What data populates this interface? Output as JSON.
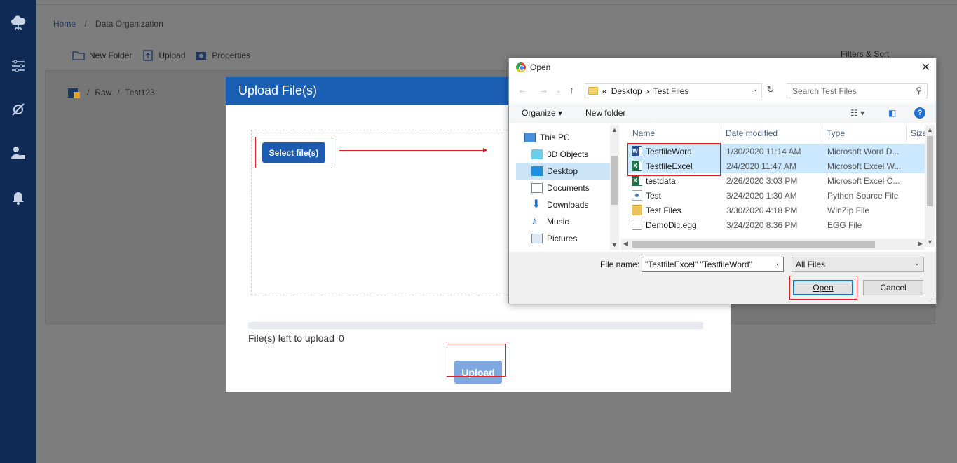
{
  "breadcrumb": {
    "home": "Home",
    "current": "Data Organization"
  },
  "toolbar": {
    "new_folder": "New Folder",
    "upload": "Upload",
    "properties": "Properties",
    "filters": "Filters & Sort"
  },
  "path": {
    "raw": "Raw",
    "folder": "Test123"
  },
  "modal": {
    "title": "Upload File(s)",
    "select_button": "Select file(s)",
    "files_left_label": "File(s) left to upload",
    "files_left_count": "0",
    "upload_button": "Upload",
    "upload_progress": 0
  },
  "dialog": {
    "title": "Open",
    "address": {
      "prefix": "«",
      "crumb1": "Desktop",
      "crumb2": "Test Files"
    },
    "search_placeholder": "Search Test Files",
    "organize": "Organize",
    "new_folder": "New folder",
    "nav_items": [
      "This PC",
      "3D Objects",
      "Desktop",
      "Documents",
      "Downloads",
      "Music",
      "Pictures"
    ],
    "columns": {
      "name": "Name",
      "date": "Date modified",
      "type": "Type",
      "size": "Size"
    },
    "files": [
      {
        "name": "TestfileWord",
        "date": "1/30/2020 11:14 AM",
        "type": "Microsoft Word D...",
        "icon": "word-icon"
      },
      {
        "name": "TestfileExcel",
        "date": "2/4/2020 11:47 AM",
        "type": "Microsoft Excel W...",
        "icon": "excel-icon"
      },
      {
        "name": "testdata",
        "date": "2/26/2020 3:03 PM",
        "type": "Microsoft Excel C...",
        "icon": "excel-icon"
      },
      {
        "name": "Test",
        "date": "3/24/2020 1:30 AM",
        "type": "Python Source File",
        "icon": "python-icon"
      },
      {
        "name": "Test Files",
        "date": "3/30/2020 4:18 PM",
        "type": "WinZip File",
        "icon": "zip-icon"
      },
      {
        "name": "DemoDic.egg",
        "date": "3/24/2020 8:36 PM",
        "type": "EGG File",
        "icon": "file-icon"
      }
    ],
    "file_name_label": "File name:",
    "file_name_value": "\"TestfileExcel\" \"TestfileWord\"",
    "file_type": "All Files",
    "open_button": "Open",
    "cancel_button": "Cancel"
  }
}
